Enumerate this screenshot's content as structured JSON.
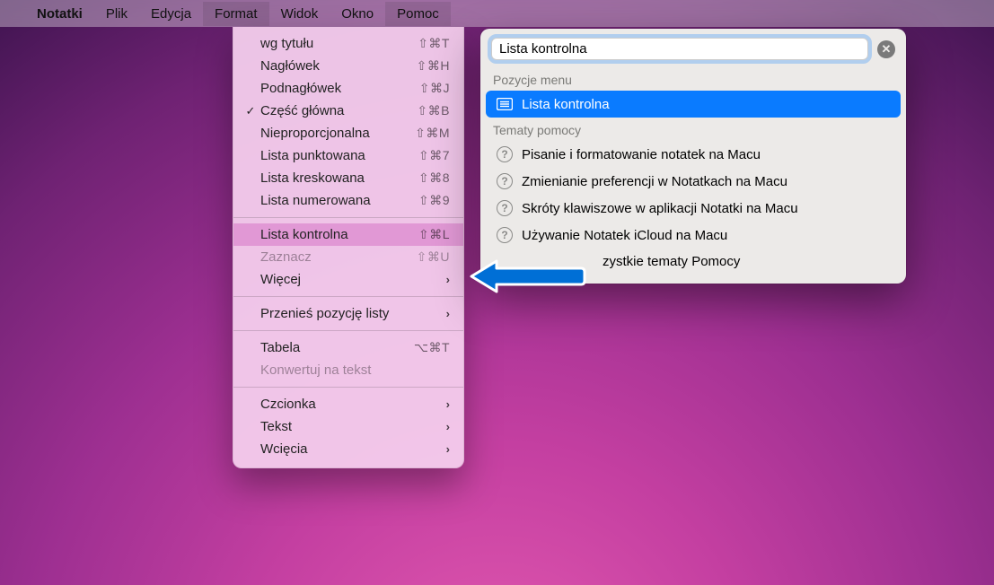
{
  "menubar": {
    "app_name": "Notatki",
    "items": [
      "Plik",
      "Edycja",
      "Format",
      "Widok",
      "Okno",
      "Pomoc"
    ],
    "open_index": 2
  },
  "format_menu": {
    "items": [
      {
        "label": "wg tytułu",
        "shortcut": "⇧⌘T",
        "checked": false
      },
      {
        "label": "Nagłówek",
        "shortcut": "⇧⌘H",
        "checked": false
      },
      {
        "label": "Podnagłówek",
        "shortcut": "⇧⌘J",
        "checked": false
      },
      {
        "label": "Część główna",
        "shortcut": "⇧⌘B",
        "checked": true
      },
      {
        "label": "Nieproporcjonalna",
        "shortcut": "⇧⌘M",
        "checked": false
      },
      {
        "label": "Lista punktowana",
        "shortcut": "⇧⌘7",
        "checked": false
      },
      {
        "label": "Lista kreskowana",
        "shortcut": "⇧⌘8",
        "checked": false
      },
      {
        "label": "Lista numerowana",
        "shortcut": "⇧⌘9",
        "checked": false
      }
    ],
    "checklist": {
      "label": "Lista kontrolna",
      "shortcut": "⇧⌘L"
    },
    "mark": {
      "label": "Zaznacz",
      "shortcut": "⇧⌘U",
      "disabled": true
    },
    "more": {
      "label": "Więcej"
    },
    "move_list": {
      "label": "Przenieś pozycję listy"
    },
    "table": {
      "label": "Tabela",
      "shortcut": "⌥⌘T"
    },
    "convert": {
      "label": "Konwertuj na tekst",
      "disabled": true
    },
    "font": {
      "label": "Czcionka"
    },
    "text": {
      "label": "Tekst"
    },
    "indent": {
      "label": "Wcięcia"
    }
  },
  "help_popover": {
    "search_value": "Lista kontrolna",
    "menu_section_label": "Pozycje menu",
    "menu_results": [
      {
        "label": "Lista kontrolna",
        "selected": true
      }
    ],
    "topics_section_label": "Tematy pomocy",
    "topic_results": [
      {
        "label": "Pisanie i formatowanie notatek na Macu"
      },
      {
        "label": "Zmienianie preferencji w Notatkach na Macu"
      },
      {
        "label": "Skróty klawiszowe w aplikacji Notatki na Macu"
      },
      {
        "label": "Używanie Notatek iCloud na Macu"
      }
    ],
    "show_all_label": "zystkie tematy Pomocy"
  }
}
